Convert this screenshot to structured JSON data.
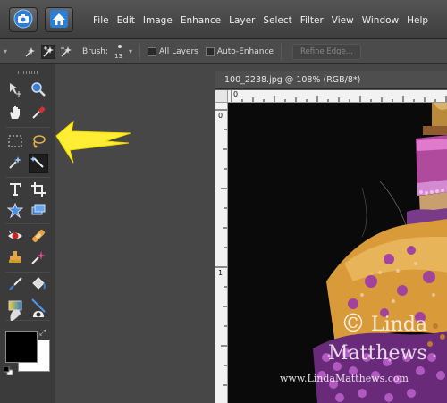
{
  "menubar": {
    "items": [
      "File",
      "Edit",
      "Image",
      "Enhance",
      "Layer",
      "Select",
      "Filter",
      "View",
      "Window",
      "Help"
    ]
  },
  "options": {
    "brush_label": "Brush:",
    "brush_size": "13",
    "all_layers_label": "All Layers",
    "auto_enhance_label": "Auto-Enhance",
    "refine_edge_label": "Refine Edge..."
  },
  "document": {
    "title": "100_2238.jpg @ 108% (RGB/8*)",
    "ruler_top_label": "0",
    "ruler_left_label_0": "0",
    "ruler_left_label_1": "1"
  },
  "watermark": {
    "copyright": "©",
    "first_name": "Linda",
    "last_name": "Matthews",
    "url": "www.LindaMatthews.com"
  },
  "colors": {
    "foreground": "#000000",
    "background": "#ffffff",
    "annotation_arrow": "#ffee33"
  }
}
